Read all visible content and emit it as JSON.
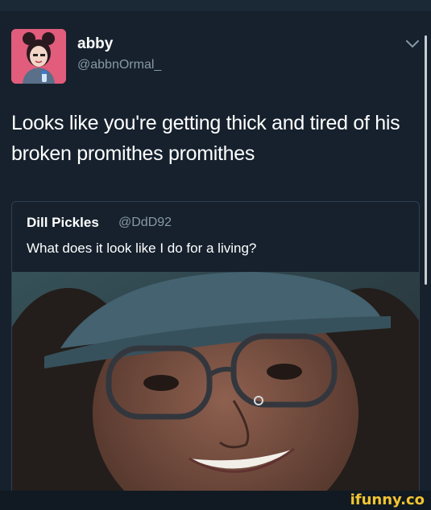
{
  "tweet": {
    "author_name": "abby",
    "author_handle": "@abbnOrmal_",
    "menu_icon": "chevron-down-icon",
    "text": "Looks like you're getting thick and tired of his broken promithes promithes"
  },
  "quoted_tweet": {
    "author_name": "Dill Pickles",
    "author_handle": "@DdD92",
    "text": "What does it look like I do for a living?"
  },
  "watermark": {
    "text": "ifunny.co"
  },
  "colors": {
    "background": "#16212d",
    "text": "#ffffff",
    "muted": "#8899a6",
    "border": "#2f3f50",
    "watermark": "#f4c430"
  }
}
